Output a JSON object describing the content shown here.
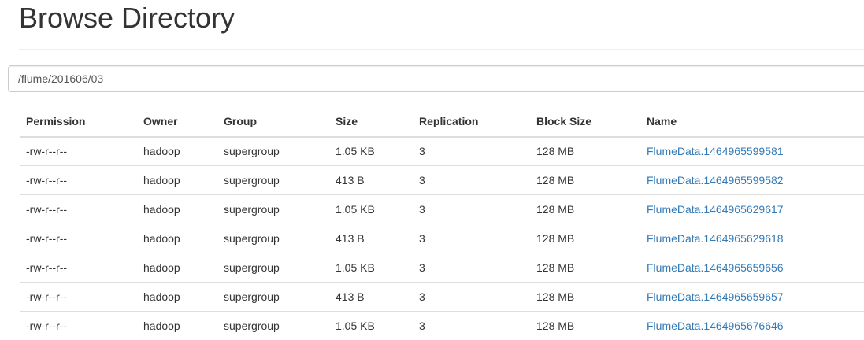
{
  "header": {
    "title": "Browse Directory"
  },
  "path_input": {
    "value": "/flume/201606/03"
  },
  "table": {
    "columns": [
      "Permission",
      "Owner",
      "Group",
      "Size",
      "Replication",
      "Block Size",
      "Name"
    ],
    "rows": [
      [
        "-rw-r--r--",
        "hadoop",
        "supergroup",
        "1.05 KB",
        "3",
        "128 MB",
        "FlumeData.1464965599581"
      ],
      [
        "-rw-r--r--",
        "hadoop",
        "supergroup",
        "413 B",
        "3",
        "128 MB",
        "FlumeData.1464965599582"
      ],
      [
        "-rw-r--r--",
        "hadoop",
        "supergroup",
        "1.05 KB",
        "3",
        "128 MB",
        "FlumeData.1464965629617"
      ],
      [
        "-rw-r--r--",
        "hadoop",
        "supergroup",
        "413 B",
        "3",
        "128 MB",
        "FlumeData.1464965629618"
      ],
      [
        "-rw-r--r--",
        "hadoop",
        "supergroup",
        "1.05 KB",
        "3",
        "128 MB",
        "FlumeData.1464965659656"
      ],
      [
        "-rw-r--r--",
        "hadoop",
        "supergroup",
        "413 B",
        "3",
        "128 MB",
        "FlumeData.1464965659657"
      ],
      [
        "-rw-r--r--",
        "hadoop",
        "supergroup",
        "1.05 KB",
        "3",
        "128 MB",
        "FlumeData.1464965676646"
      ]
    ]
  },
  "colors": {
    "text": "#333333",
    "link": "#337ab7",
    "border": "#dddddd"
  }
}
